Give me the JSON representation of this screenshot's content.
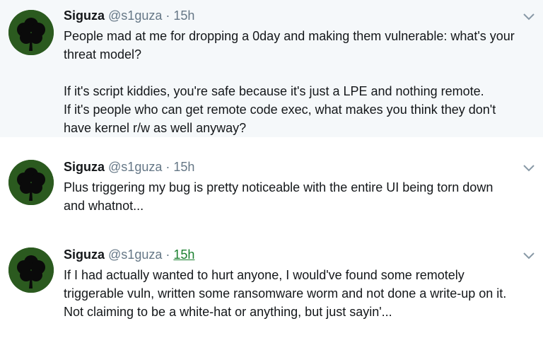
{
  "tweets": [
    {
      "name": "Siguza",
      "handle": "@s1guza",
      "separator": "·",
      "time": "15h",
      "lines": [
        "People mad at me for dropping a 0day and making them vulnerable: what's your",
        "threat model?",
        "",
        "If it's script kiddies, you're safe because it's just a LPE and nothing remote.",
        "If it's people who can get remote code exec, what makes you think they don't",
        "have kernel r/w as well anyway?"
      ]
    },
    {
      "name": "Siguza",
      "handle": "@s1guza",
      "separator": "·",
      "time": "15h",
      "lines": [
        "Plus triggering my bug is pretty noticeable with the entire UI being torn down",
        "and whatnot..."
      ]
    },
    {
      "name": "Siguza",
      "handle": "@s1guza",
      "separator": "·",
      "time": "15h",
      "lines": [
        "If I had actually wanted to hurt anyone, I would've found some remotely",
        "triggerable vuln, written some ransomware worm and not done a write-up on it.",
        "Not claiming to be a white-hat or anything, but just sayin'..."
      ]
    }
  ],
  "icons": {
    "avatar": "clover-avatar",
    "menu": "chevron-down-icon"
  },
  "colors": {
    "highlight_bg": "#f5f8fa",
    "secondary_text": "#657786",
    "avatar_bg": "#2b5a1f",
    "clover": "#0a0a0a"
  }
}
